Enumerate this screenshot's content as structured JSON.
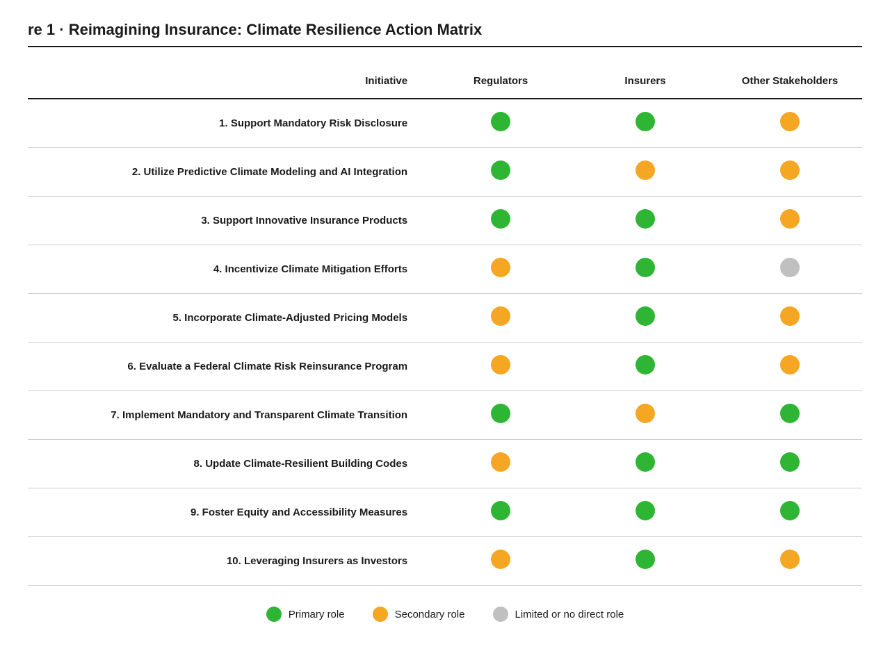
{
  "title": "re 1  ·  Reimagining Insurance: Climate Resilience Action Matrix",
  "table": {
    "headers": {
      "initiative": "Initiative",
      "regulators": "Regulators",
      "insurers": "Insurers",
      "other": "Other Stakeholders"
    },
    "rows": [
      {
        "initiative": "1. Support Mandatory Risk Disclosure",
        "regulators": "green",
        "insurers": "green",
        "other": "orange"
      },
      {
        "initiative": "2. Utilize Predictive Climate Modeling and AI Integration",
        "regulators": "green",
        "insurers": "orange",
        "other": "orange"
      },
      {
        "initiative": "3. Support Innovative Insurance Products",
        "regulators": "green",
        "insurers": "green",
        "other": "orange"
      },
      {
        "initiative": "4. Incentivize Climate Mitigation Efforts",
        "regulators": "orange",
        "insurers": "green",
        "other": "gray"
      },
      {
        "initiative": "5. Incorporate Climate-Adjusted Pricing Models",
        "regulators": "orange",
        "insurers": "green",
        "other": "orange"
      },
      {
        "initiative": "6. Evaluate a Federal Climate Risk Reinsurance Program",
        "regulators": "orange",
        "insurers": "green",
        "other": "orange"
      },
      {
        "initiative": "7. Implement Mandatory and Transparent Climate Transition",
        "regulators": "green",
        "insurers": "orange",
        "other": "green"
      },
      {
        "initiative": "8. Update Climate-Resilient Building Codes",
        "regulators": "orange",
        "insurers": "green",
        "other": "green"
      },
      {
        "initiative": "9. Foster Equity and Accessibility Measures",
        "regulators": "green",
        "insurers": "green",
        "other": "green"
      },
      {
        "initiative": "10. Leveraging Insurers as Investors",
        "regulators": "orange",
        "insurers": "green",
        "other": "orange"
      }
    ]
  },
  "legend": {
    "primary": "Primary role",
    "secondary": "Secondary role",
    "limited": "Limited or no direct role"
  }
}
